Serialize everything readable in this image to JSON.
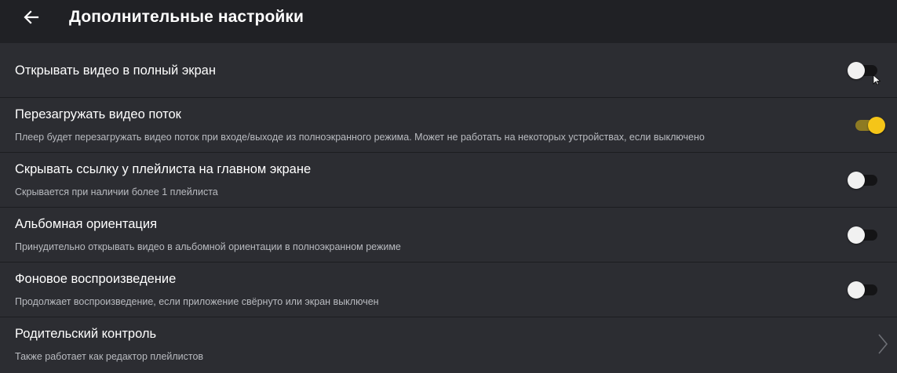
{
  "header": {
    "title": "Дополнительные настройки",
    "back_icon": "arrow-left-icon"
  },
  "settings": [
    {
      "label": "Открывать видео в полный экран",
      "description": "",
      "control": "toggle",
      "enabled": false
    },
    {
      "label": "Перезагружать видео поток",
      "description": "Плеер будет перезагружать видео поток при входе/выходе из полноэкранного режима. Может не работать на некоторых устройствах, если выключено",
      "control": "toggle",
      "enabled": true
    },
    {
      "label": "Скрывать ссылку у плейлиста на главном экране",
      "description": "Скрывается при наличии более 1 плейлиста",
      "control": "toggle",
      "enabled": false
    },
    {
      "label": "Альбомная ориентация",
      "description": "Принудительно открывать видео в альбомной ориентации в полноэкранном режиме",
      "control": "toggle",
      "enabled": false
    },
    {
      "label": "Фоновое воспроизведение",
      "description": "Продолжает воспроизведение, если приложение свёрнуто или экран выключен",
      "control": "toggle",
      "enabled": false
    },
    {
      "label": "Родительский контроль",
      "description": "Также работает как редактор плейлистов",
      "control": "chevron-right-icon"
    }
  ],
  "colors": {
    "background": "#2c2d32",
    "appbar": "#202125",
    "accent": "#f5c518",
    "accent_track": "#8d7a23"
  }
}
